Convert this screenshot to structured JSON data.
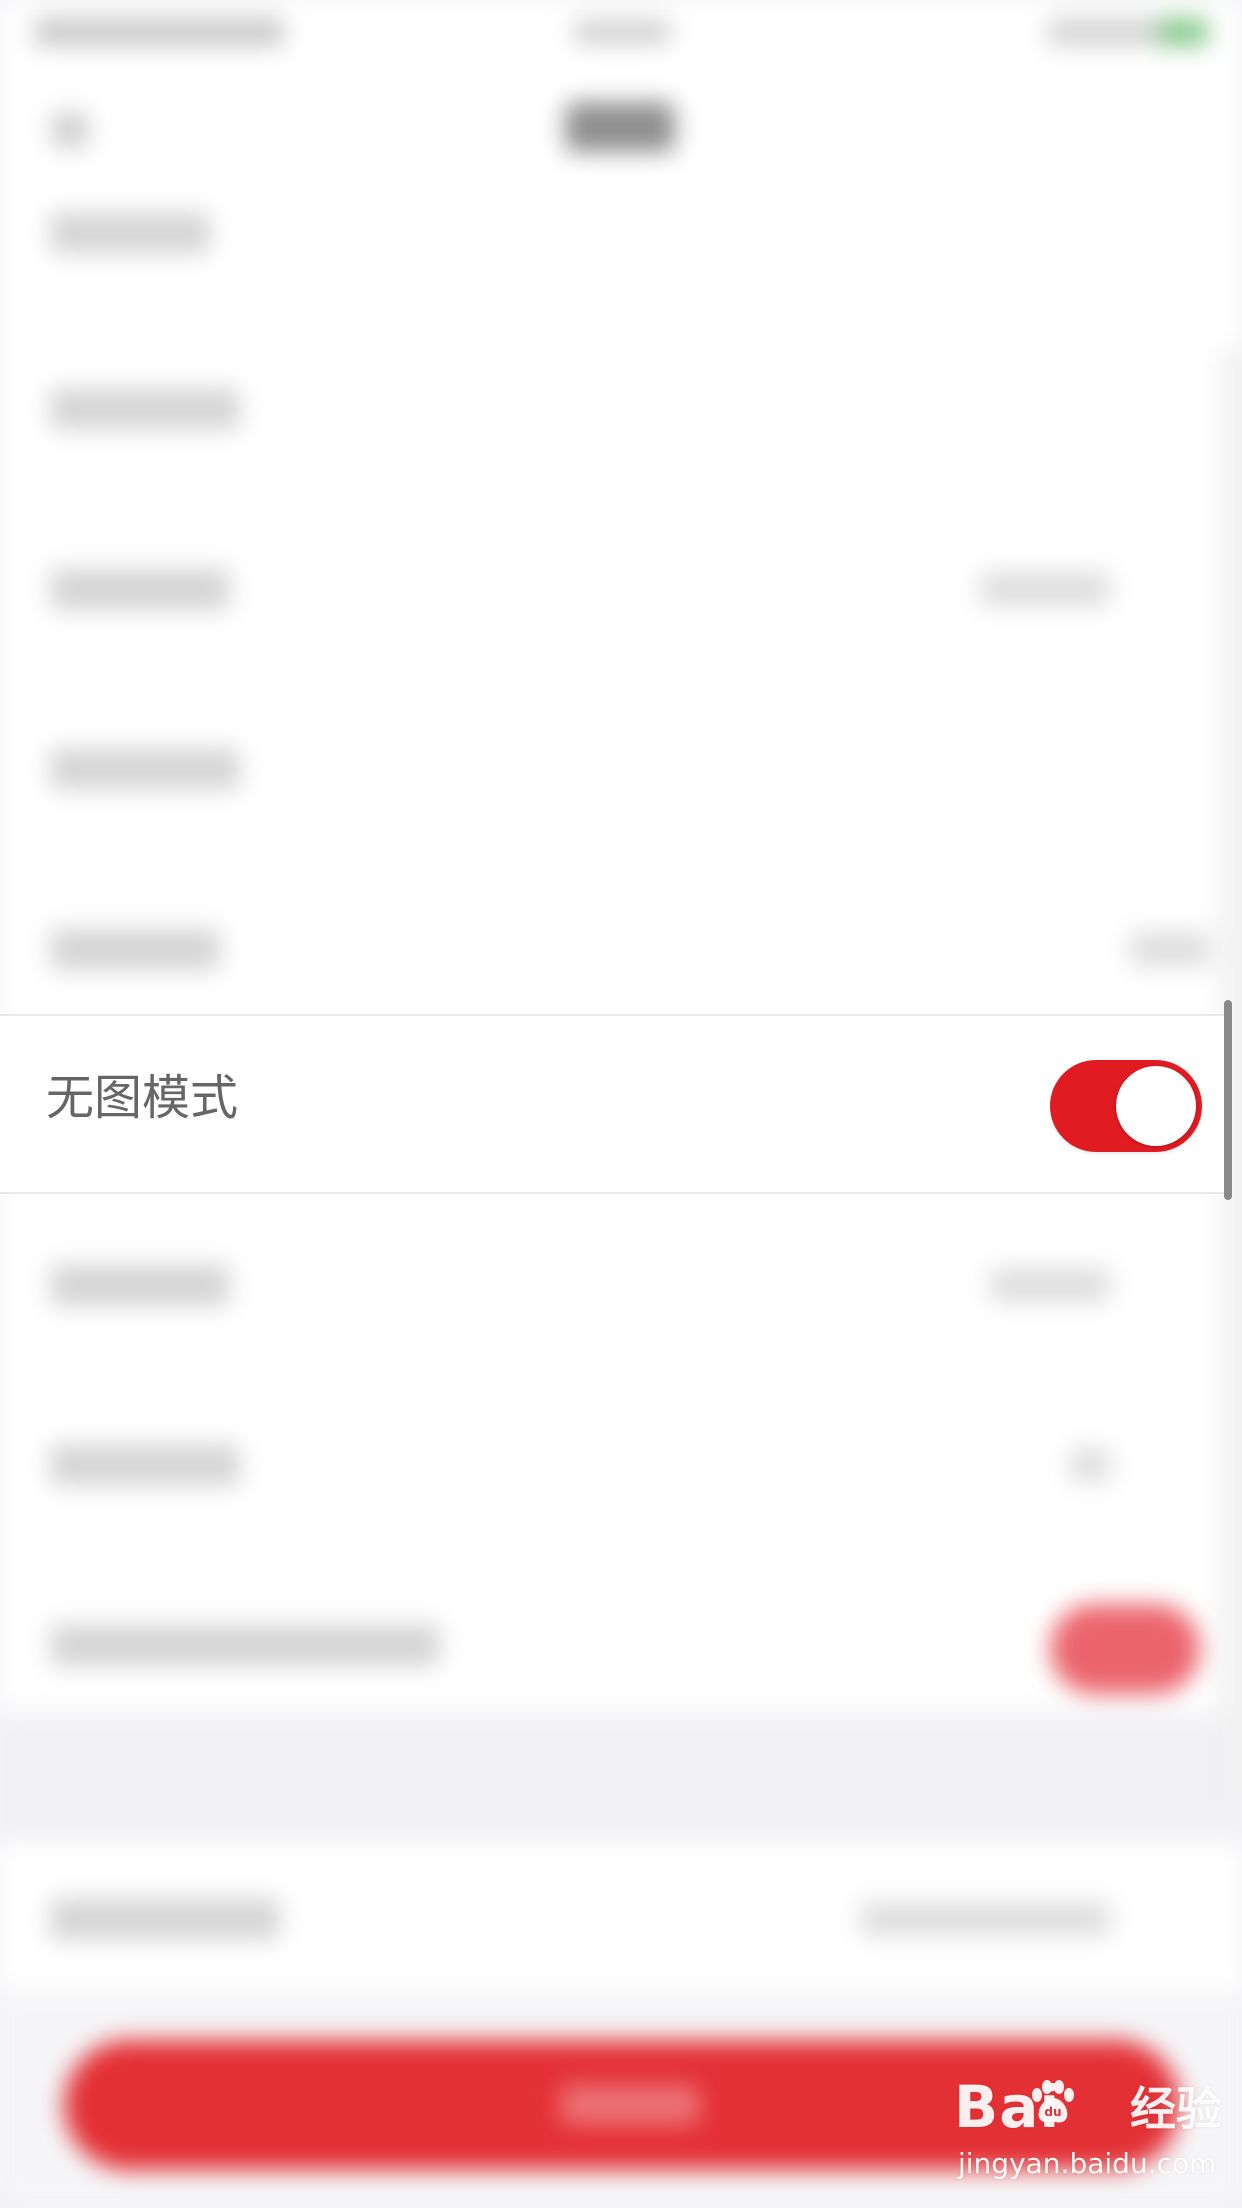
{
  "settings": {
    "focused_row": {
      "label": "无图模式",
      "toggle_on": true,
      "toggle_icon": "toggle-switch-icon"
    }
  },
  "colors": {
    "accent": "#e01b22",
    "switch_knob": "#ffffff",
    "label_text": "#666666",
    "divider": "#e9e9ec"
  },
  "watermark": {
    "word_left": "Bai",
    "word_right": "经验",
    "url": "jingyan.baidu.com",
    "icon": "baidu-paw-icon"
  }
}
